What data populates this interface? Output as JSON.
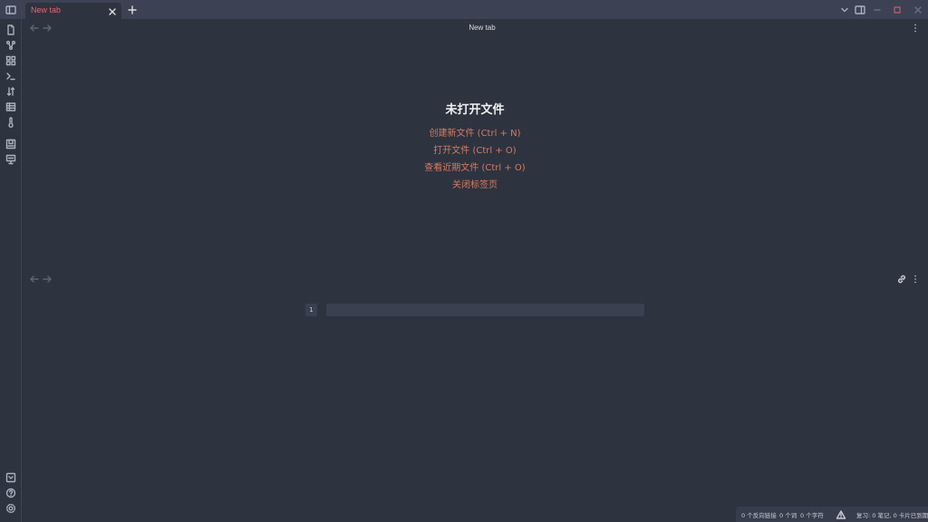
{
  "tab": {
    "label": "New tab"
  },
  "header": {
    "title": "New tab"
  },
  "empty_state": {
    "title": "未打开文件",
    "actions": [
      "创建新文件 (Ctrl + N)",
      "打开文件 (Ctrl + O)",
      "查看近期文件 (Ctrl + O)",
      "关闭标签页"
    ]
  },
  "editor": {
    "line_number": "1"
  },
  "status": {
    "backlinks": "0 个反向链接",
    "words": "0 个词",
    "chars": "0 个字符",
    "review": "复习: 0 笔记, 0 卡片已到期"
  },
  "colors": {
    "accent": "#d27c61",
    "tab_active": "#e4666f",
    "background": "#2e3340"
  }
}
